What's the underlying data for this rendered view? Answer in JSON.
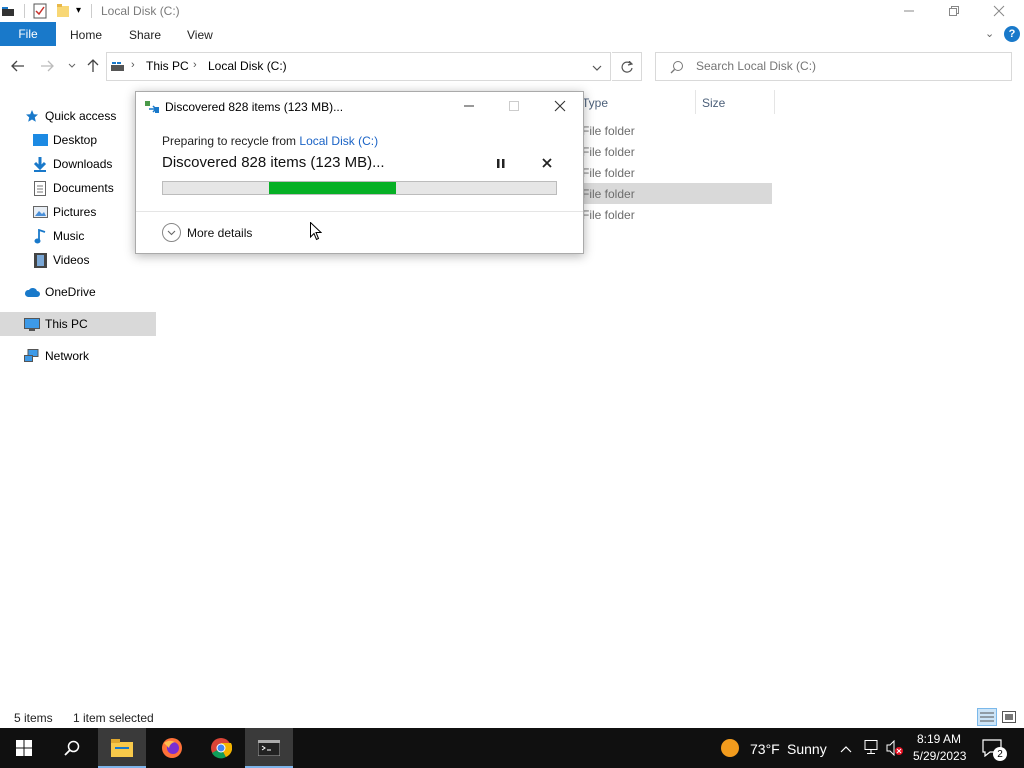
{
  "window": {
    "title": "Local Disk (C:)"
  },
  "ribbon": {
    "tabs": [
      {
        "label": "File"
      },
      {
        "label": "Home"
      },
      {
        "label": "Share"
      },
      {
        "label": "View"
      }
    ]
  },
  "address": {
    "crumbs": [
      "This PC",
      "Local Disk (C:)"
    ],
    "search_placeholder": "Search Local Disk (C:)"
  },
  "sidebar": {
    "items": [
      {
        "label": "Quick access",
        "icon": "star-icon"
      },
      {
        "label": "Desktop",
        "icon": "desktop-folder-icon"
      },
      {
        "label": "Downloads",
        "icon": "downloads-icon"
      },
      {
        "label": "Documents",
        "icon": "documents-icon"
      },
      {
        "label": "Pictures",
        "icon": "pictures-icon"
      },
      {
        "label": "Music",
        "icon": "music-icon"
      },
      {
        "label": "Videos",
        "icon": "videos-icon"
      },
      {
        "label": "OneDrive",
        "icon": "cloud-icon"
      },
      {
        "label": "This PC",
        "icon": "computer-icon",
        "selected": true
      },
      {
        "label": "Network",
        "icon": "network-icon"
      }
    ]
  },
  "filelist": {
    "columns": [
      "Type",
      "Size"
    ],
    "rows": [
      {
        "type": "File folder"
      },
      {
        "type": "File folder"
      },
      {
        "type": "File folder"
      },
      {
        "type": "File folder",
        "selected": true
      },
      {
        "type": "File folder"
      }
    ]
  },
  "status": {
    "item_count": "5 items",
    "selection": "1 item selected"
  },
  "dialog": {
    "title": "Discovered 828 items (123 MB)...",
    "subtitle_prefix": "Preparing to recycle from",
    "subtitle_link": "Local Disk (C:)",
    "main_text": "Discovered 828 items (123 MB)...",
    "more_details": "More details"
  },
  "taskbar": {
    "weather_temp": "73°F",
    "weather_desc": "Sunny",
    "time": "8:19 AM",
    "date": "5/29/2023",
    "notification_count": "2"
  },
  "colors": {
    "accent": "#1979ca",
    "progress": "#06b025",
    "link": "#1a63c6"
  }
}
